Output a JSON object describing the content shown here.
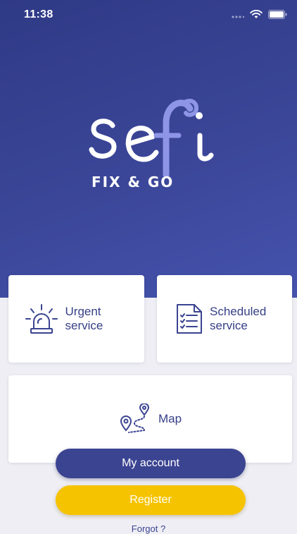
{
  "status": {
    "time": "11:38"
  },
  "logo": {
    "word": "sefi",
    "tagline": "FIX & GO"
  },
  "cards": {
    "urgent": {
      "label_line1": "Urgent",
      "label_line2": "service",
      "icon": "siren-icon"
    },
    "scheduled": {
      "label_line1": "Scheduled",
      "label_line2": "service",
      "icon": "checklist-icon"
    },
    "map": {
      "label": "Map",
      "icon": "map-route-icon"
    }
  },
  "buttons": {
    "account": "My account",
    "register": "Register"
  },
  "footer": {
    "forgot": "Forgot ?"
  },
  "colors": {
    "brand": "#3b4491",
    "accent": "#f6c300",
    "logo_accent": "#8e95e6"
  }
}
